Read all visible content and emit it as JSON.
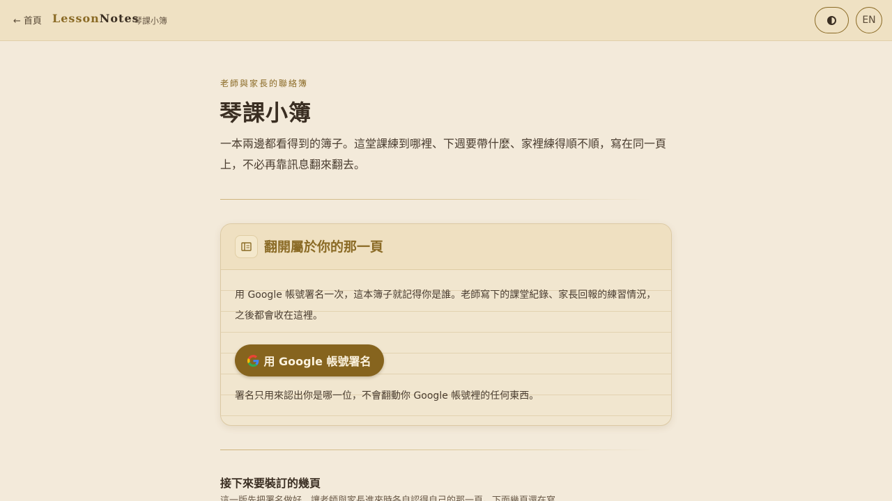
{
  "header": {
    "back_arrow": "←",
    "back_label": "首頁",
    "brand_part1": "Lesson",
    "brand_part2": "Notes",
    "crumb": "琴課小簿",
    "lang_label": "EN"
  },
  "hero": {
    "eyebrow": "老師與家長的聯絡簿",
    "title": "琴課小簿",
    "intro": "一本兩邊都看得到的簿子。這堂課練到哪裡、下週要帶什麼、家裡練得順不順，寫在同一頁上，不必再靠訊息翻來翻去。"
  },
  "card": {
    "icon": "book-icon",
    "title": "翻開屬於你的那一頁",
    "text": "用 Google 帳號署名一次，這本簿子就記得你是誰。老師寫下的課堂紀錄、家長回報的練習情況，之後都會收在這裡。",
    "button_label": "用 Google 帳號署名",
    "note": "署名只用來認出你是哪一位，不會翻動你 Google 帳號裡的任何東西。"
  },
  "next": {
    "title": "接下來要裝訂的幾頁",
    "text": "這一版先把署名做好，讓老師與家長進來時各自認得自己的那一頁。下面幾頁還在寫"
  },
  "colors": {
    "accent": "#86641e",
    "background": "#f3eada",
    "header_bg": "#efe1c3"
  }
}
